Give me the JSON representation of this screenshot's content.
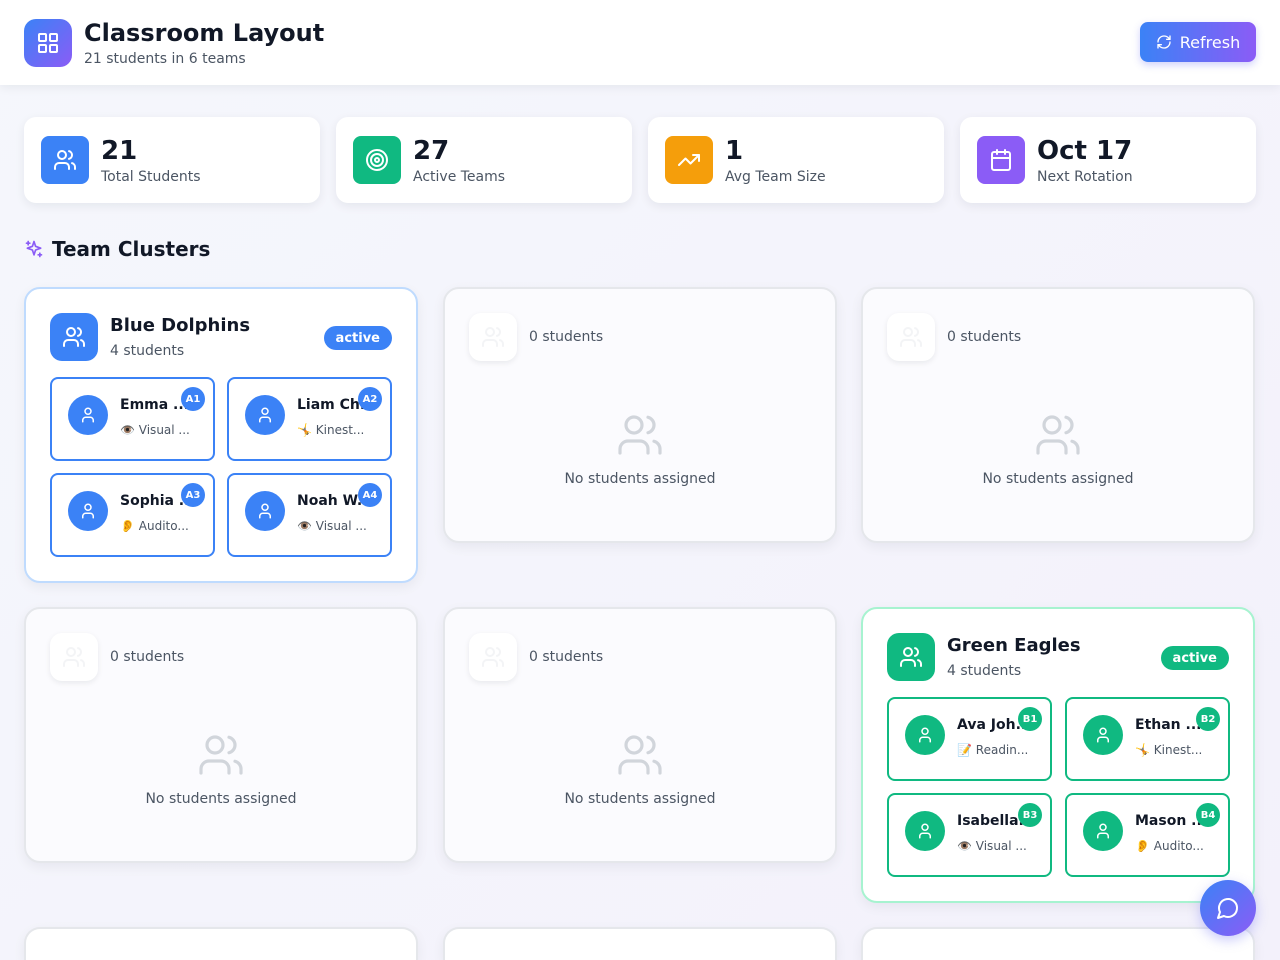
{
  "header": {
    "title": "Classroom Layout",
    "subtitle": "21 students in 6 teams",
    "refresh_label": "Refresh"
  },
  "stats": [
    {
      "value": "21",
      "label": "Total Students",
      "icon": "users-icon",
      "color": "#3b82f6"
    },
    {
      "value": "27",
      "label": "Active Teams",
      "icon": "target-icon",
      "color": "#10b981"
    },
    {
      "value": "1",
      "label": "Avg Team Size",
      "icon": "trending-up-icon",
      "color": "#f59e0b"
    },
    {
      "value": "Oct 17",
      "label": "Next Rotation",
      "icon": "calendar-icon",
      "color": "#8b5cf6"
    }
  ],
  "section": {
    "title": "Team Clusters",
    "icon": "sparkles-icon"
  },
  "teams": {
    "blue": {
      "name": "Blue Dolphins",
      "count": "4 students",
      "status": "active",
      "color": "#3b82f6",
      "students": [
        {
          "name": "Emma ...",
          "style": "Visual ...",
          "style_icon": "👁️",
          "seat": "A1"
        },
        {
          "name": "Liam Ch...",
          "style": "Kinest...",
          "style_icon": "🤸",
          "seat": "A2"
        },
        {
          "name": "Sophia ...",
          "style": "Audito...",
          "style_icon": "👂",
          "seat": "A3"
        },
        {
          "name": "Noah W...",
          "style": "Visual ...",
          "style_icon": "👁️",
          "seat": "A4"
        }
      ]
    },
    "green": {
      "name": "Green Eagles",
      "count": "4 students",
      "status": "active",
      "color": "#10b981",
      "students": [
        {
          "name": "Ava Joh...",
          "style": "Readin...",
          "style_icon": "📝",
          "seat": "B1"
        },
        {
          "name": "Ethan ...",
          "style": "Kinest...",
          "style_icon": "🤸",
          "seat": "B2"
        },
        {
          "name": "Isabella...",
          "style": "Visual ...",
          "style_icon": "👁️",
          "seat": "B3"
        },
        {
          "name": "Mason ...",
          "style": "Audito...",
          "style_icon": "👂",
          "seat": "B4"
        }
      ]
    },
    "empty_count": "0 students",
    "empty_message": "No students assigned"
  },
  "chat": {
    "icon": "message-circle-icon"
  }
}
